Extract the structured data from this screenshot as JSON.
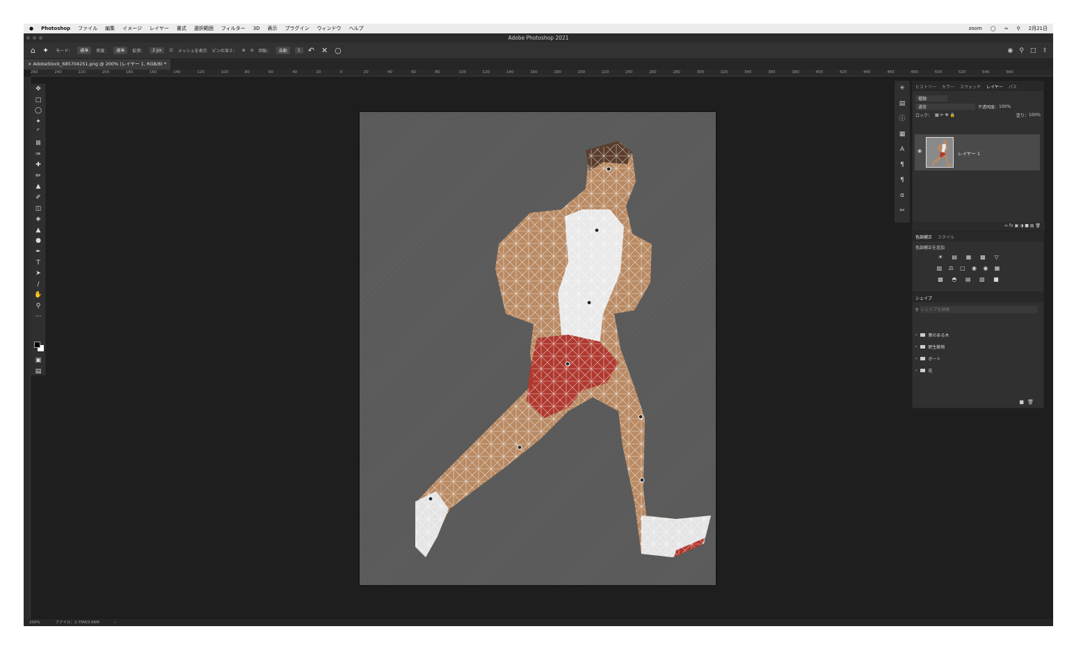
{
  "menubar": {
    "apple": "",
    "app": "Photoshop",
    "items": [
      "ファイル",
      "編集",
      "イメージ",
      "レイヤー",
      "書式",
      "選択範囲",
      "フィルター",
      "3D",
      "表示",
      "プラグイン",
      "ウィンドウ",
      "ヘルプ"
    ],
    "right": [
      "zoom",
      "2月21日"
    ]
  },
  "window": {
    "title": "Adobe Photoshop 2021"
  },
  "options": {
    "mode_label": "モード：",
    "mode_value": "標準",
    "density_label": "密度：",
    "density_value": "標準",
    "expand_label": "拡張：",
    "expand_value": "2 px",
    "show_mesh": "メッシュを表示",
    "pin_depth": "ピンの深さ：",
    "rotate_label": "回転：",
    "rotate_value": "自動",
    "rotate_num": "1"
  },
  "document": {
    "tab": "AdobeStock_685704251.png @ 200% (レイヤー 1, RGB/8) *"
  },
  "ruler": {
    "h_ticks": [
      "260",
      "240",
      "220",
      "200",
      "180",
      "160",
      "140",
      "120",
      "100",
      "80",
      "60",
      "40",
      "20",
      "0",
      "20",
      "40",
      "60",
      "80",
      "100",
      "120",
      "140",
      "160",
      "180",
      "200",
      "220",
      "240",
      "260",
      "280",
      "300",
      "320",
      "340",
      "360",
      "380",
      "400",
      "420",
      "440",
      "460",
      "480",
      "500",
      "520",
      "540",
      "560"
    ]
  },
  "layers_panel": {
    "tabs": [
      "ヒストリー",
      "カラー",
      "スウォッチ",
      "レイヤー",
      "パス"
    ],
    "active_tab": "レイヤー",
    "filter_kind": "種類",
    "blend_mode": "通常",
    "opacity_label": "不透明度：",
    "opacity": "100%",
    "lock_label": "ロック：",
    "fill_label": "塗り：",
    "fill": "100%",
    "layer_name": "レイヤー 1"
  },
  "adjust_panel": {
    "tabs": [
      "色調補正",
      "スタイル"
    ],
    "caption": "色調補正を追加"
  },
  "shapes_panel": {
    "title": "シェイプ",
    "search_placeholder": "シェイプを検索",
    "folders": [
      "葉のある木",
      "野生動物",
      "ボート",
      "花"
    ]
  },
  "status": {
    "zoom": "200%",
    "file": "ファイル：2.75M/3.66M"
  },
  "colors": {
    "accent": "#4a4a4a",
    "shorts": "#b0392f",
    "skin": "#b98a63"
  }
}
